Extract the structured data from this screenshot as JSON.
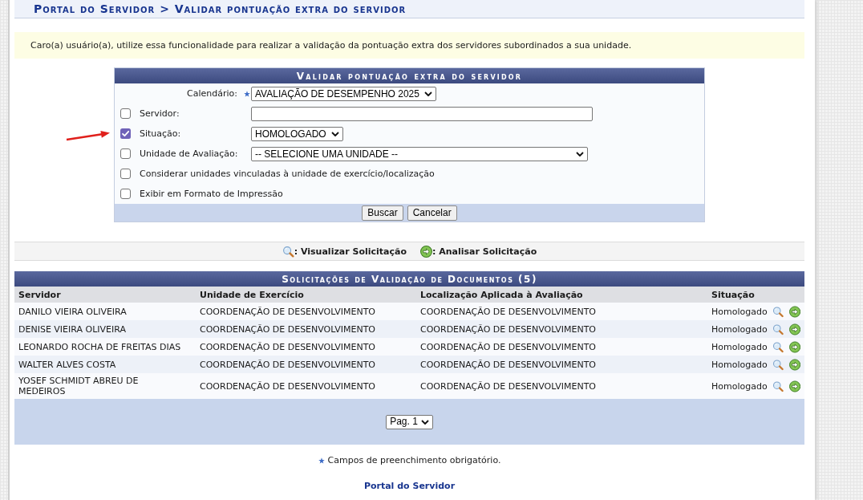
{
  "page_title": "Portal do Servidor > Validar pontuação extra do servidor",
  "notice": "Caro(a) usuário(a), utilize essa funcionalidade para realizar a validação da pontuação extra dos servidores subordinados a sua unidade.",
  "search_form": {
    "title": "Validar pontuação extra do servidor",
    "calendar": {
      "label": "Calendário:",
      "required": true,
      "value": "AVALIAÇÃO DE DESEMPENHO 2025"
    },
    "filters": [
      {
        "kind": "text",
        "label": "Servidor:",
        "checked": false
      },
      {
        "kind": "select",
        "label": "Situação:",
        "checked": true,
        "value": "HOMOLOGADO"
      },
      {
        "kind": "select",
        "label": "Unidade de Avaliação:",
        "checked": false,
        "value": "-- SELECIONE UMA UNIDADE --"
      },
      {
        "kind": "option",
        "label": "Considerar unidades vinculadas à unidade de exercício/localização",
        "checked": false
      },
      {
        "kind": "option",
        "label": "Exibir em Formato de Impressão",
        "checked": false
      }
    ],
    "buttons": [
      "Buscar",
      "Cancelar"
    ]
  },
  "legend": [
    {
      "kind": "view",
      "label": ": Visualizar Solicitação"
    },
    {
      "kind": "analyze",
      "label": ": Analisar Solicitação"
    }
  ],
  "results": {
    "title": "Solicitações de Validação de Documentos (5)",
    "columns": [
      "Servidor",
      "Unidade de Exercício",
      "Localização Aplicada à Avaliação",
      "Situação"
    ],
    "rows": [
      {
        "servidor": "DANILO VIEIRA OLIVEIRA",
        "unidade_exercicio": "COORDENAÇÃO DE DESENVOLVIMENTO",
        "localizacao": "COORDENAÇÃO DE DESENVOLVIMENTO",
        "situacao": "Homologado"
      },
      {
        "servidor": "DENISE VIEIRA OLIVEIRA",
        "unidade_exercicio": "COORDENAÇÃO DE DESENVOLVIMENTO",
        "localizacao": "COORDENAÇÃO DE DESENVOLVIMENTO",
        "situacao": "Homologado"
      },
      {
        "servidor": "LEONARDO ROCHA DE FREITAS DIAS",
        "unidade_exercicio": "COORDENAÇÃO DE DESENVOLVIMENTO",
        "localizacao": "COORDENAÇÃO DE DESENVOLVIMENTO",
        "situacao": "Homologado"
      },
      {
        "servidor": "WALTER ALVES COSTA",
        "unidade_exercicio": "COORDENAÇÃO DE DESENVOLVIMENTO",
        "localizacao": "COORDENAÇÃO DE DESENVOLVIMENTO",
        "situacao": "Homologado"
      },
      {
        "servidor": "YOSEF SCHMIDT ABREU DE MEDEIROS",
        "unidade_exercicio": "COORDENAÇÃO DE DESENVOLVIMENTO",
        "localizacao": "COORDENAÇÃO DE DESENVOLVIMENTO",
        "situacao": "Homologado"
      }
    ],
    "page": "Pag. 1"
  },
  "required_note": "Campos de preenchimento obrigatório.",
  "footer_link": "Portal do Servidor"
}
